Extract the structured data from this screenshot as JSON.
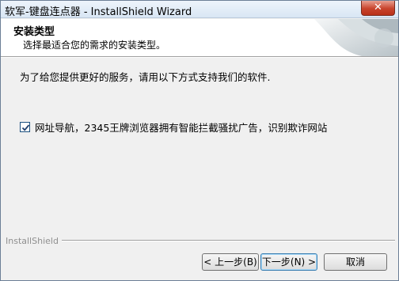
{
  "window": {
    "title": "软军-键盘连点器 - InstallShield Wizard",
    "close_label": "✕"
  },
  "header": {
    "title": "安装类型",
    "subtitle": "选择最适合您的需求的安装类型。"
  },
  "main": {
    "description": "为了给您提供更好的服务，请用以下方式支持我们的软件.",
    "option": {
      "label": "网址导航，2345王牌浏览器拥有智能拦截骚扰广告，识别欺诈网站",
      "checked": true
    }
  },
  "footer": {
    "brand": "InstallShield",
    "back_label": "< 上一步(B)",
    "next_label": "下一步(N) >",
    "cancel_label": "取消"
  },
  "colors": {
    "window_bg": "#f0f0f0",
    "header_bg": "#ffffff",
    "close_red": "#c8432c"
  }
}
